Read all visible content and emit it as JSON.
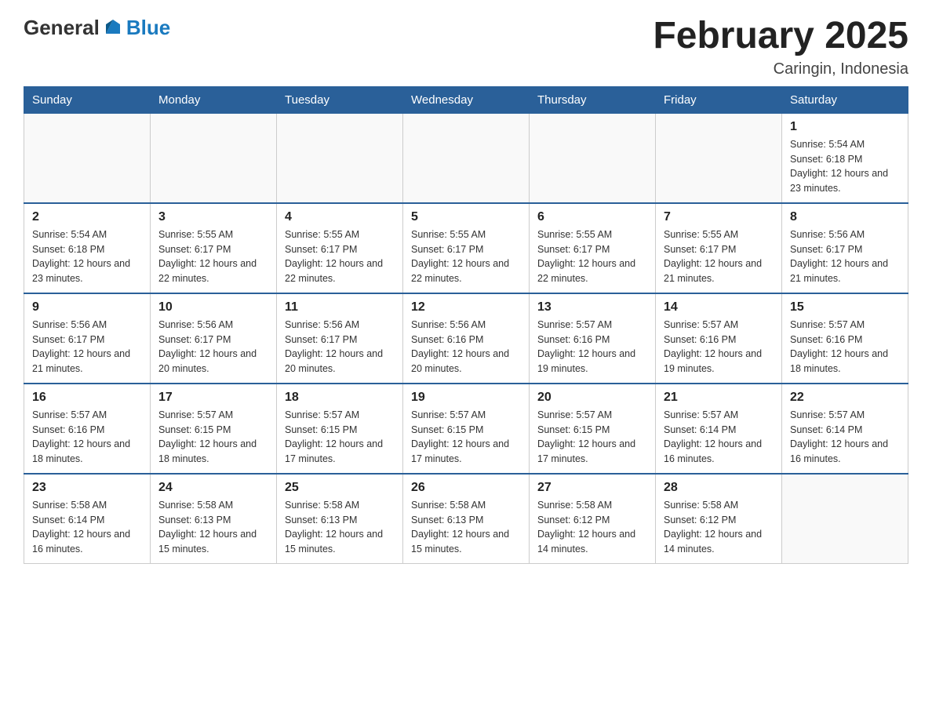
{
  "header": {
    "logo": {
      "general": "General",
      "blue": "Blue"
    },
    "title": "February 2025",
    "location": "Caringin, Indonesia"
  },
  "days_of_week": [
    "Sunday",
    "Monday",
    "Tuesday",
    "Wednesday",
    "Thursday",
    "Friday",
    "Saturday"
  ],
  "weeks": [
    [
      {
        "day": "",
        "info": ""
      },
      {
        "day": "",
        "info": ""
      },
      {
        "day": "",
        "info": ""
      },
      {
        "day": "",
        "info": ""
      },
      {
        "day": "",
        "info": ""
      },
      {
        "day": "",
        "info": ""
      },
      {
        "day": "1",
        "info": "Sunrise: 5:54 AM\nSunset: 6:18 PM\nDaylight: 12 hours and 23 minutes."
      }
    ],
    [
      {
        "day": "2",
        "info": "Sunrise: 5:54 AM\nSunset: 6:18 PM\nDaylight: 12 hours and 23 minutes."
      },
      {
        "day": "3",
        "info": "Sunrise: 5:55 AM\nSunset: 6:17 PM\nDaylight: 12 hours and 22 minutes."
      },
      {
        "day": "4",
        "info": "Sunrise: 5:55 AM\nSunset: 6:17 PM\nDaylight: 12 hours and 22 minutes."
      },
      {
        "day": "5",
        "info": "Sunrise: 5:55 AM\nSunset: 6:17 PM\nDaylight: 12 hours and 22 minutes."
      },
      {
        "day": "6",
        "info": "Sunrise: 5:55 AM\nSunset: 6:17 PM\nDaylight: 12 hours and 22 minutes."
      },
      {
        "day": "7",
        "info": "Sunrise: 5:55 AM\nSunset: 6:17 PM\nDaylight: 12 hours and 21 minutes."
      },
      {
        "day": "8",
        "info": "Sunrise: 5:56 AM\nSunset: 6:17 PM\nDaylight: 12 hours and 21 minutes."
      }
    ],
    [
      {
        "day": "9",
        "info": "Sunrise: 5:56 AM\nSunset: 6:17 PM\nDaylight: 12 hours and 21 minutes."
      },
      {
        "day": "10",
        "info": "Sunrise: 5:56 AM\nSunset: 6:17 PM\nDaylight: 12 hours and 20 minutes."
      },
      {
        "day": "11",
        "info": "Sunrise: 5:56 AM\nSunset: 6:17 PM\nDaylight: 12 hours and 20 minutes."
      },
      {
        "day": "12",
        "info": "Sunrise: 5:56 AM\nSunset: 6:16 PM\nDaylight: 12 hours and 20 minutes."
      },
      {
        "day": "13",
        "info": "Sunrise: 5:57 AM\nSunset: 6:16 PM\nDaylight: 12 hours and 19 minutes."
      },
      {
        "day": "14",
        "info": "Sunrise: 5:57 AM\nSunset: 6:16 PM\nDaylight: 12 hours and 19 minutes."
      },
      {
        "day": "15",
        "info": "Sunrise: 5:57 AM\nSunset: 6:16 PM\nDaylight: 12 hours and 18 minutes."
      }
    ],
    [
      {
        "day": "16",
        "info": "Sunrise: 5:57 AM\nSunset: 6:16 PM\nDaylight: 12 hours and 18 minutes."
      },
      {
        "day": "17",
        "info": "Sunrise: 5:57 AM\nSunset: 6:15 PM\nDaylight: 12 hours and 18 minutes."
      },
      {
        "day": "18",
        "info": "Sunrise: 5:57 AM\nSunset: 6:15 PM\nDaylight: 12 hours and 17 minutes."
      },
      {
        "day": "19",
        "info": "Sunrise: 5:57 AM\nSunset: 6:15 PM\nDaylight: 12 hours and 17 minutes."
      },
      {
        "day": "20",
        "info": "Sunrise: 5:57 AM\nSunset: 6:15 PM\nDaylight: 12 hours and 17 minutes."
      },
      {
        "day": "21",
        "info": "Sunrise: 5:57 AM\nSunset: 6:14 PM\nDaylight: 12 hours and 16 minutes."
      },
      {
        "day": "22",
        "info": "Sunrise: 5:57 AM\nSunset: 6:14 PM\nDaylight: 12 hours and 16 minutes."
      }
    ],
    [
      {
        "day": "23",
        "info": "Sunrise: 5:58 AM\nSunset: 6:14 PM\nDaylight: 12 hours and 16 minutes."
      },
      {
        "day": "24",
        "info": "Sunrise: 5:58 AM\nSunset: 6:13 PM\nDaylight: 12 hours and 15 minutes."
      },
      {
        "day": "25",
        "info": "Sunrise: 5:58 AM\nSunset: 6:13 PM\nDaylight: 12 hours and 15 minutes."
      },
      {
        "day": "26",
        "info": "Sunrise: 5:58 AM\nSunset: 6:13 PM\nDaylight: 12 hours and 15 minutes."
      },
      {
        "day": "27",
        "info": "Sunrise: 5:58 AM\nSunset: 6:12 PM\nDaylight: 12 hours and 14 minutes."
      },
      {
        "day": "28",
        "info": "Sunrise: 5:58 AM\nSunset: 6:12 PM\nDaylight: 12 hours and 14 minutes."
      },
      {
        "day": "",
        "info": ""
      }
    ]
  ]
}
